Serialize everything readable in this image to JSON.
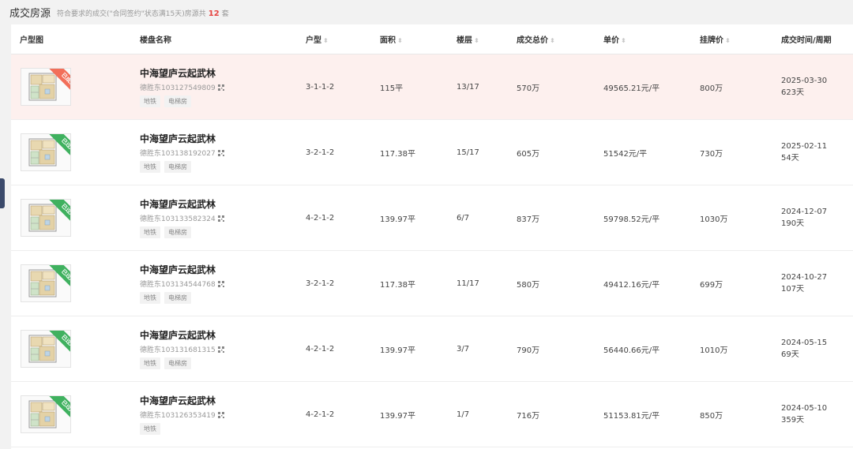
{
  "header": {
    "title": "成交房源",
    "summary_prefix": "符合要求的成交(\"合同签约\"状态满15天)房源共",
    "count": "12",
    "summary_suffix": "套"
  },
  "table": {
    "columns": [
      "户型图",
      "楼盘名称",
      "户型",
      "面积",
      "楼层",
      "成交总价",
      "单价",
      "挂牌价",
      "成交时间/周期"
    ],
    "rows": [
      {
        "ribbon": "已成交",
        "ribbon_color": "#f26f5a",
        "name": "中海望庐云起武林",
        "code": "德胜东103127549809",
        "tags": [
          "地铁",
          "电梯房"
        ],
        "layout": "3-1-1-2",
        "area": "115平",
        "floor": "13/17",
        "total": "570万",
        "unit": "49565.21元/平",
        "list_price": "800万",
        "date": "2025-03-30",
        "cycle": "623天"
      },
      {
        "ribbon": "已过户",
        "ribbon_color": "#3fb15f",
        "name": "中海望庐云起武林",
        "code": "德胜东103138192027",
        "tags": [
          "地铁",
          "电梯房"
        ],
        "layout": "3-2-1-2",
        "area": "117.38平",
        "floor": "15/17",
        "total": "605万",
        "unit": "51542元/平",
        "list_price": "730万",
        "date": "2025-02-11",
        "cycle": "54天"
      },
      {
        "ribbon": "已过户",
        "ribbon_color": "#3fb15f",
        "name": "中海望庐云起武林",
        "code": "德胜东103133582324",
        "tags": [
          "地铁",
          "电梯房"
        ],
        "layout": "4-2-1-2",
        "area": "139.97平",
        "floor": "6/7",
        "total": "837万",
        "unit": "59798.52元/平",
        "list_price": "1030万",
        "date": "2024-12-07",
        "cycle": "190天"
      },
      {
        "ribbon": "已过户",
        "ribbon_color": "#3fb15f",
        "name": "中海望庐云起武林",
        "code": "德胜东103134544768",
        "tags": [
          "地铁",
          "电梯房"
        ],
        "layout": "3-2-1-2",
        "area": "117.38平",
        "floor": "11/17",
        "total": "580万",
        "unit": "49412.16元/平",
        "list_price": "699万",
        "date": "2024-10-27",
        "cycle": "107天"
      },
      {
        "ribbon": "已过户",
        "ribbon_color": "#3fb15f",
        "name": "中海望庐云起武林",
        "code": "德胜东103131681315",
        "tags": [
          "地铁",
          "电梯房"
        ],
        "layout": "4-2-1-2",
        "area": "139.97平",
        "floor": "3/7",
        "total": "790万",
        "unit": "56440.66元/平",
        "list_price": "1010万",
        "date": "2024-05-15",
        "cycle": "69天"
      },
      {
        "ribbon": "已过户",
        "ribbon_color": "#3fb15f",
        "name": "中海望庐云起武林",
        "code": "德胜东103126353419",
        "tags": [
          "地铁"
        ],
        "layout": "4-2-1-2",
        "area": "139.97平",
        "floor": "1/7",
        "total": "716万",
        "unit": "51153.81元/平",
        "list_price": "850万",
        "date": "2024-05-10",
        "cycle": "359天"
      }
    ]
  }
}
